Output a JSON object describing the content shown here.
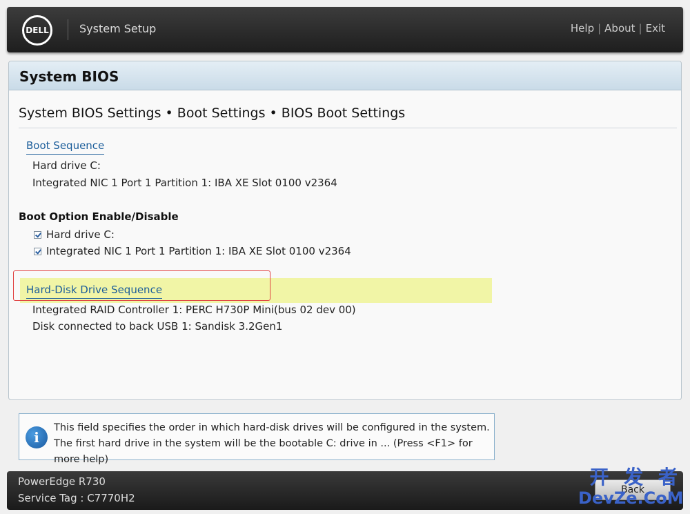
{
  "header": {
    "logo_text": "DELL",
    "title": "System Setup",
    "links": {
      "help": "Help",
      "about": "About",
      "exit": "Exit",
      "separator": "|"
    }
  },
  "panel": {
    "title": "System BIOS",
    "breadcrumb": "System BIOS Settings • Boot Settings • BIOS Boot Settings",
    "boot_sequence": {
      "label": "Boot Sequence",
      "items": [
        "Hard drive C:",
        "Integrated NIC 1 Port 1 Partition 1: IBA XE Slot 0100 v2364"
      ]
    },
    "boot_option": {
      "label": "Boot Option Enable/Disable",
      "items": [
        "Hard drive C:",
        "Integrated NIC 1 Port 1 Partition 1: IBA XE Slot 0100 v2364"
      ]
    },
    "hdd_sequence": {
      "label": "Hard-Disk Drive Sequence",
      "items": [
        "Integrated RAID Controller 1: PERC H730P Mini(bus 02 dev 00)",
        "Disk connected to back USB 1: Sandisk 3.2Gen1"
      ]
    }
  },
  "help": {
    "text": "This field specifies the order in which hard-disk drives will be configured in the system. The first hard drive in the system will be the bootable C: drive in ... (Press <F1> for more help)"
  },
  "footer": {
    "model": "PowerEdge R730",
    "service_tag": "Service Tag : C7770H2",
    "back_label": "Back"
  },
  "watermark": {
    "cn": "开 发 者",
    "en": "DevZe.CoM"
  },
  "colors": {
    "link": "#1b5d9a",
    "highlight": "#f1f5a6",
    "annotation": "#e04040",
    "header_bg": "#2a2a2a"
  }
}
